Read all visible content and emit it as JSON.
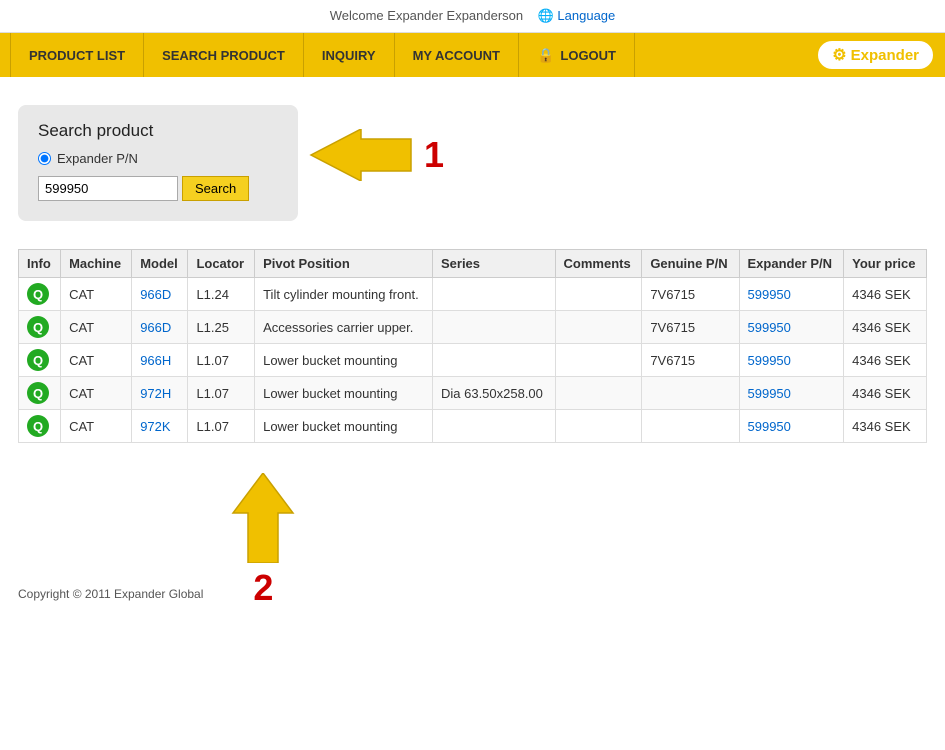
{
  "topBar": {
    "welcome": "Welcome Expander Expanderson",
    "languageLabel": "Language"
  },
  "nav": {
    "items": [
      {
        "id": "product-list",
        "label": "PRODUCT LIST"
      },
      {
        "id": "search-product",
        "label": "SEARCH PRODUCT"
      },
      {
        "id": "inquiry",
        "label": "INQUIRY"
      },
      {
        "id": "my-account",
        "label": "MY ACCOUNT"
      },
      {
        "id": "logout",
        "label": "LOGOUT"
      }
    ],
    "logo": "Expander"
  },
  "searchPanel": {
    "title": "Search product",
    "radioLabel": "Expander P/N",
    "inputValue": "599950",
    "buttonLabel": "Search",
    "annotation1": "1"
  },
  "table": {
    "headers": [
      "Info",
      "Machine",
      "Model",
      "Locator",
      "Pivot Position",
      "Series",
      "Comments",
      "Genuine P/N",
      "Expander P/N",
      "Your price"
    ],
    "rows": [
      {
        "info": "Q",
        "machine": "CAT",
        "model": "966D",
        "locator": "L1.24",
        "pivot": "Tilt cylinder mounting front.",
        "series": "",
        "comments": "",
        "genuine": "7V6715",
        "expander": "599950",
        "price": "4346 SEK"
      },
      {
        "info": "Q",
        "machine": "CAT",
        "model": "966D",
        "locator": "L1.25",
        "pivot": "Accessories carrier upper.",
        "series": "",
        "comments": "",
        "genuine": "7V6715",
        "expander": "599950",
        "price": "4346 SEK"
      },
      {
        "info": "Q",
        "machine": "CAT",
        "model": "966H",
        "locator": "L1.07",
        "pivot": "Lower bucket mounting",
        "series": "",
        "comments": "",
        "genuine": "7V6715",
        "expander": "599950",
        "price": "4346 SEK"
      },
      {
        "info": "Q",
        "machine": "CAT",
        "model": "972H",
        "locator": "L1.07",
        "pivot": "Lower bucket mounting",
        "series": "Dia 63.50x258.00",
        "comments": "",
        "genuine": "",
        "expander": "599950",
        "price": "4346 SEK"
      },
      {
        "info": "Q",
        "machine": "CAT",
        "model": "972K",
        "locator": "L1.07",
        "pivot": "Lower bucket mounting",
        "series": "",
        "comments": "",
        "genuine": "",
        "expander": "599950",
        "price": "4346 SEK"
      }
    ]
  },
  "footer": {
    "copyright": "Copyright © 2011 Expander Global",
    "annotation2": "2"
  }
}
